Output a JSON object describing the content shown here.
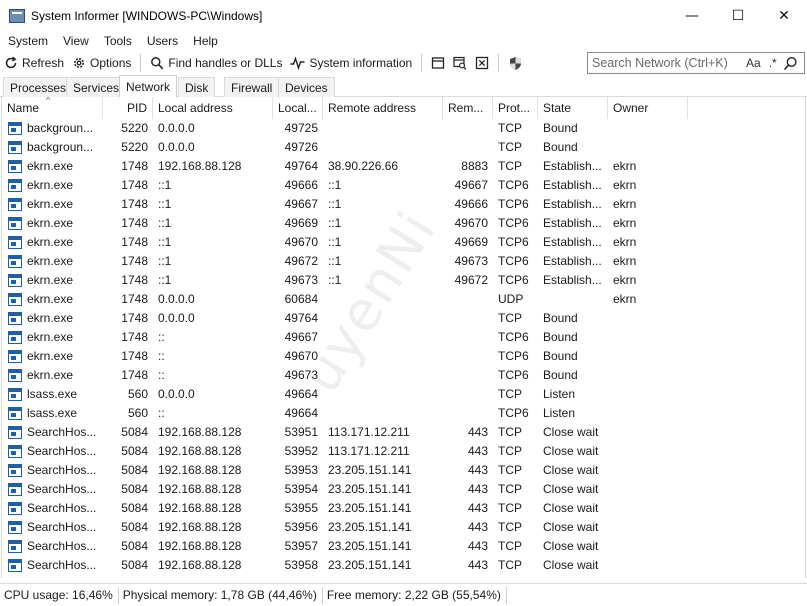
{
  "window": {
    "title": "System Informer [WINDOWS-PC\\Windows]",
    "minimize": "—",
    "maximize": "☐",
    "close": "✕"
  },
  "menu": [
    "System",
    "View",
    "Tools",
    "Users",
    "Help"
  ],
  "toolbar": {
    "refresh": "Refresh",
    "options": "Options",
    "find": "Find handles or DLLs",
    "sysinfo": "System information",
    "search_placeholder": "Search Network (Ctrl+K)",
    "search_case": "Aa",
    "search_regex": ".*"
  },
  "tabs": [
    "Processes",
    "Services",
    "Network",
    "Disk",
    "Firewall",
    "Devices"
  ],
  "columns": [
    "Name",
    "PID",
    "Local address",
    "Local...",
    "Remote address",
    "Rem...",
    "Prot...",
    "State",
    "Owner"
  ],
  "rows": [
    {
      "name": "backgroun...",
      "pid": "5220",
      "laddr": "0.0.0.0",
      "lport": "49725",
      "raddr": "",
      "rport": "",
      "proto": "TCP",
      "state": "Bound",
      "owner": ""
    },
    {
      "name": "backgroun...",
      "pid": "5220",
      "laddr": "0.0.0.0",
      "lport": "49726",
      "raddr": "",
      "rport": "",
      "proto": "TCP",
      "state": "Bound",
      "owner": ""
    },
    {
      "name": "ekrn.exe",
      "pid": "1748",
      "laddr": "192.168.88.128",
      "lport": "49764",
      "raddr": "38.90.226.66",
      "rport": "8883",
      "proto": "TCP",
      "state": "Establish...",
      "owner": "ekrn"
    },
    {
      "name": "ekrn.exe",
      "pid": "1748",
      "laddr": "::1",
      "lport": "49666",
      "raddr": "::1",
      "rport": "49667",
      "proto": "TCP6",
      "state": "Establish...",
      "owner": "ekrn"
    },
    {
      "name": "ekrn.exe",
      "pid": "1748",
      "laddr": "::1",
      "lport": "49667",
      "raddr": "::1",
      "rport": "49666",
      "proto": "TCP6",
      "state": "Establish...",
      "owner": "ekrn"
    },
    {
      "name": "ekrn.exe",
      "pid": "1748",
      "laddr": "::1",
      "lport": "49669",
      "raddr": "::1",
      "rport": "49670",
      "proto": "TCP6",
      "state": "Establish...",
      "owner": "ekrn"
    },
    {
      "name": "ekrn.exe",
      "pid": "1748",
      "laddr": "::1",
      "lport": "49670",
      "raddr": "::1",
      "rport": "49669",
      "proto": "TCP6",
      "state": "Establish...",
      "owner": "ekrn"
    },
    {
      "name": "ekrn.exe",
      "pid": "1748",
      "laddr": "::1",
      "lport": "49672",
      "raddr": "::1",
      "rport": "49673",
      "proto": "TCP6",
      "state": "Establish...",
      "owner": "ekrn"
    },
    {
      "name": "ekrn.exe",
      "pid": "1748",
      "laddr": "::1",
      "lport": "49673",
      "raddr": "::1",
      "rport": "49672",
      "proto": "TCP6",
      "state": "Establish...",
      "owner": "ekrn"
    },
    {
      "name": "ekrn.exe",
      "pid": "1748",
      "laddr": "0.0.0.0",
      "lport": "60684",
      "raddr": "",
      "rport": "",
      "proto": "UDP",
      "state": "",
      "owner": "ekrn"
    },
    {
      "name": "ekrn.exe",
      "pid": "1748",
      "laddr": "0.0.0.0",
      "lport": "49764",
      "raddr": "",
      "rport": "",
      "proto": "TCP",
      "state": "Bound",
      "owner": ""
    },
    {
      "name": "ekrn.exe",
      "pid": "1748",
      "laddr": "::",
      "lport": "49667",
      "raddr": "",
      "rport": "",
      "proto": "TCP6",
      "state": "Bound",
      "owner": ""
    },
    {
      "name": "ekrn.exe",
      "pid": "1748",
      "laddr": "::",
      "lport": "49670",
      "raddr": "",
      "rport": "",
      "proto": "TCP6",
      "state": "Bound",
      "owner": ""
    },
    {
      "name": "ekrn.exe",
      "pid": "1748",
      "laddr": "::",
      "lport": "49673",
      "raddr": "",
      "rport": "",
      "proto": "TCP6",
      "state": "Bound",
      "owner": ""
    },
    {
      "name": "lsass.exe",
      "pid": "560",
      "laddr": "0.0.0.0",
      "lport": "49664",
      "raddr": "",
      "rport": "",
      "proto": "TCP",
      "state": "Listen",
      "owner": ""
    },
    {
      "name": "lsass.exe",
      "pid": "560",
      "laddr": "::",
      "lport": "49664",
      "raddr": "",
      "rport": "",
      "proto": "TCP6",
      "state": "Listen",
      "owner": ""
    },
    {
      "name": "SearchHos...",
      "pid": "5084",
      "laddr": "192.168.88.128",
      "lport": "53951",
      "raddr": "113.171.12.211",
      "rport": "443",
      "proto": "TCP",
      "state": "Close wait",
      "owner": ""
    },
    {
      "name": "SearchHos...",
      "pid": "5084",
      "laddr": "192.168.88.128",
      "lport": "53952",
      "raddr": "113.171.12.211",
      "rport": "443",
      "proto": "TCP",
      "state": "Close wait",
      "owner": ""
    },
    {
      "name": "SearchHos...",
      "pid": "5084",
      "laddr": "192.168.88.128",
      "lport": "53953",
      "raddr": "23.205.151.141",
      "rport": "443",
      "proto": "TCP",
      "state": "Close wait",
      "owner": ""
    },
    {
      "name": "SearchHos...",
      "pid": "5084",
      "laddr": "192.168.88.128",
      "lport": "53954",
      "raddr": "23.205.151.141",
      "rport": "443",
      "proto": "TCP",
      "state": "Close wait",
      "owner": ""
    },
    {
      "name": "SearchHos...",
      "pid": "5084",
      "laddr": "192.168.88.128",
      "lport": "53955",
      "raddr": "23.205.151.141",
      "rport": "443",
      "proto": "TCP",
      "state": "Close wait",
      "owner": ""
    },
    {
      "name": "SearchHos...",
      "pid": "5084",
      "laddr": "192.168.88.128",
      "lport": "53956",
      "raddr": "23.205.151.141",
      "rport": "443",
      "proto": "TCP",
      "state": "Close wait",
      "owner": ""
    },
    {
      "name": "SearchHos...",
      "pid": "5084",
      "laddr": "192.168.88.128",
      "lport": "53957",
      "raddr": "23.205.151.141",
      "rport": "443",
      "proto": "TCP",
      "state": "Close wait",
      "owner": ""
    },
    {
      "name": "SearchHos...",
      "pid": "5084",
      "laddr": "192.168.88.128",
      "lport": "53958",
      "raddr": "23.205.151.141",
      "rport": "443",
      "proto": "TCP",
      "state": "Close wait",
      "owner": ""
    }
  ],
  "status": {
    "cpu": "CPU usage: 16,46%",
    "physical": "Physical memory: 1,78 GB (44,46%)",
    "free": "Free memory: 2,22 GB (55,54%)"
  },
  "watermark": "uyenNi"
}
